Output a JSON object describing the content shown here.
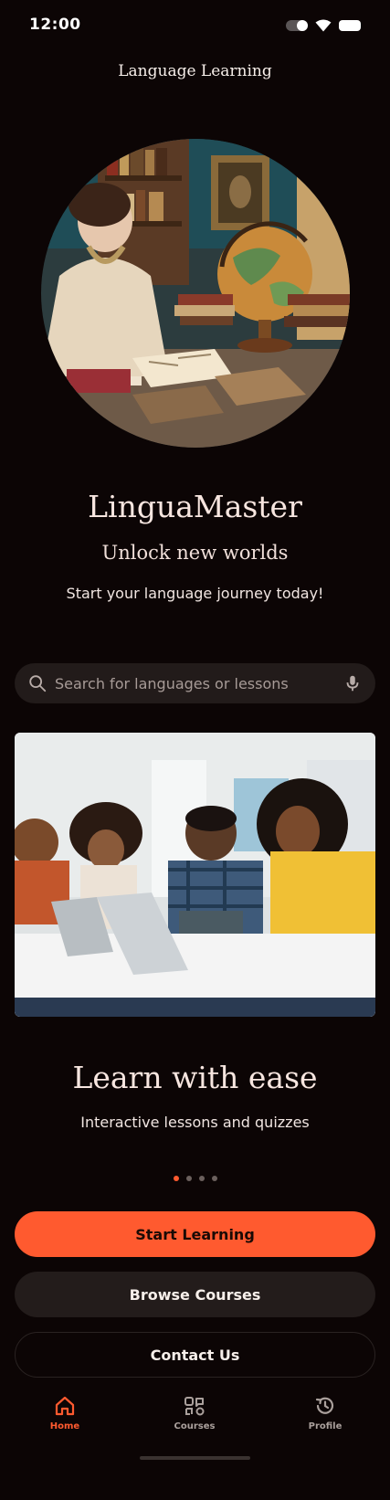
{
  "status_bar": {
    "time": "12:00"
  },
  "header": {
    "title": "Language Learning"
  },
  "hero": {
    "image": "woman reading beside globe illustration"
  },
  "brand": {
    "name": "LinguaMaster",
    "tagline": "Unlock new worlds",
    "subtitle": "Start your language journey today!"
  },
  "search": {
    "placeholder": "Search for languages or lessons",
    "icon": "search-icon",
    "mic_icon": "mic-icon"
  },
  "carousel": {
    "image": "students learning with laptops and tablets",
    "title": "Learn with ease",
    "subtitle": "Interactive lessons and quizzes",
    "page_count": 4,
    "active_index": 0
  },
  "actions": {
    "primary": "Start Learning",
    "secondary": "Browse Courses",
    "tertiary": "Contact Us"
  },
  "bottom_nav": {
    "items": [
      {
        "label": "Home",
        "icon": "home-icon",
        "active": true
      },
      {
        "label": "Courses",
        "icon": "courses-icon",
        "active": false
      },
      {
        "label": "Profile",
        "icon": "history-icon",
        "active": false
      }
    ]
  },
  "colors": {
    "background": "#0c0505",
    "accent": "#ff5a2f",
    "surface": "#231c1b"
  }
}
